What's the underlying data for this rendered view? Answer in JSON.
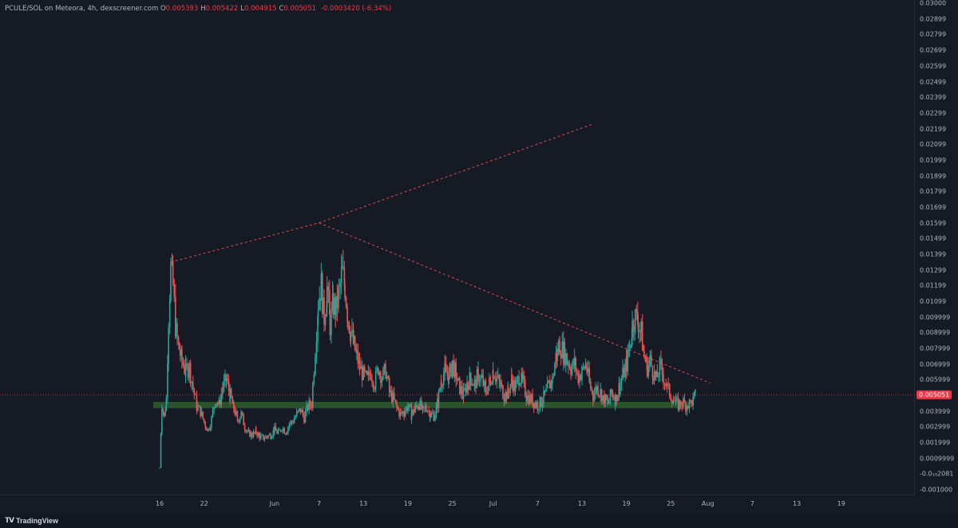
{
  "header": {
    "symbol": "PCULE/SOL on Meteora, 4h, dexscreener.com",
    "ohlc": [
      {
        "key": "O",
        "value": "0.005393"
      },
      {
        "key": "H",
        "value": "0.005422"
      },
      {
        "key": "L",
        "value": "0.004915"
      },
      {
        "key": "C",
        "value": "0.005051"
      }
    ],
    "change": "-0.0003420 (-6.34%)"
  },
  "footer": {
    "brand": "TradingView",
    "logo_icon": "tradingview-logo-icon"
  },
  "colors": {
    "up": "#26a69a",
    "down": "#ef5350",
    "background": "#161a25",
    "zone": "#2e5e2e",
    "trendline": "#ef5350"
  },
  "last_price_label": "0.005051",
  "chart_data": {
    "type": "candlestick",
    "y_axis": {
      "range": [
        -0.0013,
        0.0302
      ],
      "tick_labels": [
        "0.03000",
        "0.02899",
        "0.02799",
        "0.02699",
        "0.02599",
        "0.02499",
        "0.02399",
        "0.02299",
        "0.02199",
        "0.02099",
        "0.01999",
        "0.01899",
        "0.01799",
        "0.01699",
        "0.01599",
        "0.01499",
        "0.01399",
        "0.01299",
        "0.01199",
        "0.01099",
        "0.009999",
        "0.008999",
        "0.007999",
        "0.006999",
        "0.005999",
        "0.004999",
        "0.003999",
        "0.002999",
        "0.001999",
        "0.0009999",
        "-0.0₁₀2081",
        "-0.001000"
      ],
      "tick_values": [
        0.03,
        0.02899,
        0.02799,
        0.02699,
        0.02599,
        0.02499,
        0.02399,
        0.02299,
        0.02199,
        0.02099,
        0.01999,
        0.01899,
        0.01799,
        0.01699,
        0.01599,
        0.01499,
        0.01399,
        0.01299,
        0.01199,
        0.01099,
        0.009999,
        0.008999,
        0.007999,
        0.006999,
        0.005999,
        0.004999,
        0.003999,
        0.002999,
        0.001999,
        0.0009999,
        0.0,
        -0.001
      ]
    },
    "x_axis": {
      "tick_labels": [
        "16",
        "22",
        "Jun",
        "7",
        "13",
        "19",
        "25",
        "Jul",
        "7",
        "13",
        "19",
        "25",
        "Aug",
        "7",
        "13",
        "19"
      ],
      "tick_days": [
        0,
        6,
        15.5,
        21.5,
        27.5,
        33.5,
        39.5,
        45,
        51,
        57,
        63,
        69,
        74,
        80,
        86,
        92
      ]
    },
    "series_points": [
      [
        0.0,
        0.0004
      ],
      [
        0.3,
        0.0045
      ],
      [
        0.6,
        0.0036
      ],
      [
        0.9,
        0.0048
      ],
      [
        1.2,
        0.01
      ],
      [
        1.5,
        0.0131
      ],
      [
        1.8,
        0.012
      ],
      [
        2.2,
        0.009
      ],
      [
        2.6,
        0.008
      ],
      [
        3.0,
        0.0072
      ],
      [
        3.5,
        0.0065
      ],
      [
        4.0,
        0.0068
      ],
      [
        4.5,
        0.0055
      ],
      [
        5.0,
        0.0043
      ],
      [
        5.5,
        0.004
      ],
      [
        6.0,
        0.0033
      ],
      [
        6.5,
        0.0028
      ],
      [
        7.0,
        0.0035
      ],
      [
        7.5,
        0.0048
      ],
      [
        8.0,
        0.0044
      ],
      [
        8.5,
        0.0055
      ],
      [
        9.0,
        0.006
      ],
      [
        9.5,
        0.005
      ],
      [
        10.0,
        0.0042
      ],
      [
        10.5,
        0.0035
      ],
      [
        11.0,
        0.0038
      ],
      [
        11.5,
        0.003
      ],
      [
        12.0,
        0.0026
      ],
      [
        12.5,
        0.0025
      ],
      [
        13.0,
        0.0027
      ],
      [
        13.5,
        0.0024
      ],
      [
        14.0,
        0.0023
      ],
      [
        14.5,
        0.0024
      ],
      [
        15.0,
        0.0025
      ],
      [
        15.5,
        0.0028
      ],
      [
        16.0,
        0.0026
      ],
      [
        16.5,
        0.003
      ],
      [
        17.0,
        0.0027
      ],
      [
        17.5,
        0.0032
      ],
      [
        18.0,
        0.0034
      ],
      [
        18.5,
        0.0038
      ],
      [
        19.0,
        0.0041
      ],
      [
        19.5,
        0.0036
      ],
      [
        20.0,
        0.0043
      ],
      [
        20.5,
        0.0045
      ],
      [
        21.0,
        0.008
      ],
      [
        21.4,
        0.011
      ],
      [
        21.8,
        0.012
      ],
      [
        22.2,
        0.01
      ],
      [
        22.6,
        0.0118
      ],
      [
        23.0,
        0.0095
      ],
      [
        23.4,
        0.0108
      ],
      [
        23.8,
        0.0105
      ],
      [
        24.2,
        0.0115
      ],
      [
        24.6,
        0.0128
      ],
      [
        25.0,
        0.012
      ],
      [
        25.4,
        0.01
      ],
      [
        25.8,
        0.009
      ],
      [
        26.2,
        0.0082
      ],
      [
        26.6,
        0.0075
      ],
      [
        27.0,
        0.0068
      ],
      [
        27.5,
        0.0063
      ],
      [
        28.0,
        0.006
      ],
      [
        28.5,
        0.0065
      ],
      [
        29.0,
        0.0058
      ],
      [
        29.5,
        0.0068
      ],
      [
        30.0,
        0.0062
      ],
      [
        30.5,
        0.0066
      ],
      [
        31.0,
        0.0052
      ],
      [
        31.5,
        0.0048
      ],
      [
        32.0,
        0.0042
      ],
      [
        32.5,
        0.0038
      ],
      [
        33.0,
        0.004
      ],
      [
        33.5,
        0.0043
      ],
      [
        34.0,
        0.0038
      ],
      [
        34.5,
        0.0042
      ],
      [
        35.0,
        0.0045
      ],
      [
        35.5,
        0.004
      ],
      [
        36.0,
        0.0043
      ],
      [
        36.5,
        0.0038
      ],
      [
        37.0,
        0.0037
      ],
      [
        37.5,
        0.0045
      ],
      [
        38.0,
        0.006
      ],
      [
        38.5,
        0.0066
      ],
      [
        39.0,
        0.0062
      ],
      [
        39.5,
        0.007
      ],
      [
        40.0,
        0.0063
      ],
      [
        40.5,
        0.0055
      ],
      [
        41.0,
        0.005
      ],
      [
        41.5,
        0.0058
      ],
      [
        42.0,
        0.0061
      ],
      [
        42.5,
        0.0057
      ],
      [
        43.0,
        0.0063
      ],
      [
        43.5,
        0.006
      ],
      [
        44.0,
        0.0053
      ],
      [
        44.5,
        0.0058
      ],
      [
        45.0,
        0.0066
      ],
      [
        45.5,
        0.0061
      ],
      [
        46.0,
        0.0056
      ],
      [
        46.5,
        0.005
      ],
      [
        47.0,
        0.0052
      ],
      [
        47.5,
        0.006
      ],
      [
        48.0,
        0.0055
      ],
      [
        48.5,
        0.0062
      ],
      [
        49.0,
        0.0058
      ],
      [
        49.5,
        0.005
      ],
      [
        50.0,
        0.0048
      ],
      [
        50.5,
        0.0046
      ],
      [
        51.0,
        0.0044
      ],
      [
        51.5,
        0.0046
      ],
      [
        52.0,
        0.005
      ],
      [
        52.5,
        0.0056
      ],
      [
        53.0,
        0.006
      ],
      [
        53.5,
        0.0075
      ],
      [
        54.0,
        0.0082
      ],
      [
        54.5,
        0.0078
      ],
      [
        55.0,
        0.0073
      ],
      [
        55.5,
        0.0068
      ],
      [
        56.0,
        0.007
      ],
      [
        56.5,
        0.0062
      ],
      [
        57.0,
        0.0065
      ],
      [
        57.5,
        0.007
      ],
      [
        58.0,
        0.0058
      ],
      [
        58.5,
        0.005
      ],
      [
        59.0,
        0.0055
      ],
      [
        59.5,
        0.0052
      ],
      [
        60.0,
        0.0048
      ],
      [
        60.5,
        0.0045
      ],
      [
        61.0,
        0.0052
      ],
      [
        61.5,
        0.0048
      ],
      [
        62.0,
        0.0055
      ],
      [
        62.5,
        0.0063
      ],
      [
        63.0,
        0.007
      ],
      [
        63.4,
        0.008
      ],
      [
        63.8,
        0.0095
      ],
      [
        64.2,
        0.01
      ],
      [
        64.6,
        0.0097
      ],
      [
        65.0,
        0.009
      ],
      [
        65.4,
        0.0075
      ],
      [
        65.8,
        0.0068
      ],
      [
        66.2,
        0.0072
      ],
      [
        66.6,
        0.0065
      ],
      [
        67.0,
        0.006
      ],
      [
        67.5,
        0.0068
      ],
      [
        68.0,
        0.0062
      ],
      [
        68.5,
        0.0055
      ],
      [
        69.0,
        0.005
      ],
      [
        69.5,
        0.0046
      ],
      [
        70.0,
        0.0044
      ],
      [
        70.5,
        0.0046
      ],
      [
        71.0,
        0.0044
      ],
      [
        71.5,
        0.0045
      ],
      [
        72.0,
        0.0047
      ],
      [
        72.3,
        0.005
      ]
    ],
    "support_zone": {
      "y_low": 0.0042,
      "y_high": 0.0046,
      "x_start": 0.0,
      "x_end": 71.7
    },
    "trendlines": [
      {
        "style": "dashed",
        "from": [
          1.5,
          0.0135
        ],
        "to": [
          21.5,
          0.016
        ]
      },
      {
        "style": "dashed",
        "from": [
          21.5,
          0.016
        ],
        "to": [
          58.5,
          0.0223
        ]
      },
      {
        "style": "dashed",
        "from": [
          21.5,
          0.016
        ],
        "to": [
          74.3,
          0.0058
        ]
      }
    ],
    "last_price": 0.005051
  }
}
